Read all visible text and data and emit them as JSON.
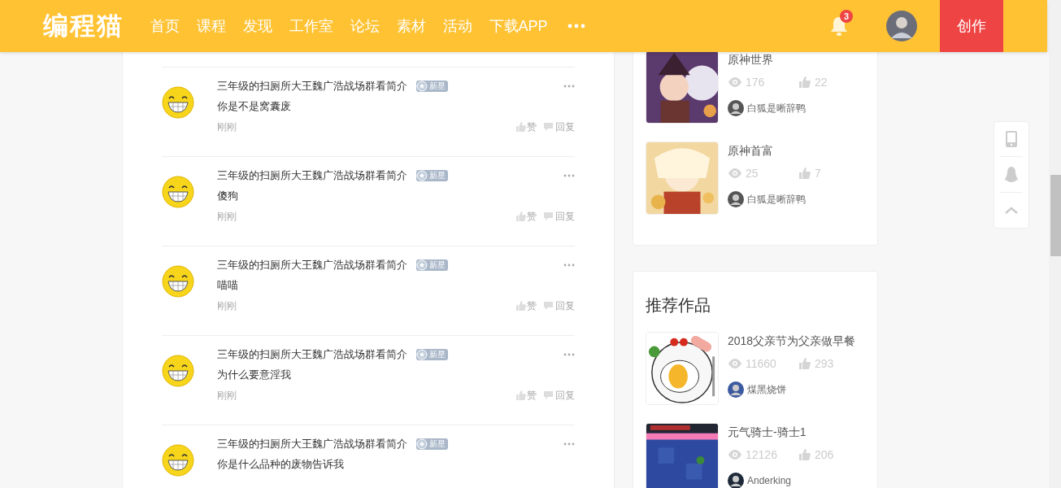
{
  "header": {
    "logo": "编程猫",
    "nav": [
      "首页",
      "课程",
      "发现",
      "工作室",
      "论坛",
      "素材",
      "活动",
      "下载APP"
    ],
    "notification_count": "3",
    "create_button": "创作"
  },
  "comments": [
    {
      "author": "三年级的扫厕所大王魏广浩战场群看简介",
      "badge": "新星",
      "text": "你是不是窝囊废",
      "time": "刚刚",
      "like": "赞",
      "reply": "回复"
    },
    {
      "author": "三年级的扫厕所大王魏广浩战场群看简介",
      "badge": "新星",
      "text": "傻狗",
      "time": "刚刚",
      "like": "赞",
      "reply": "回复"
    },
    {
      "author": "三年级的扫厕所大王魏广浩战场群看简介",
      "badge": "新星",
      "text": "喵喵",
      "time": "刚刚",
      "like": "赞",
      "reply": "回复"
    },
    {
      "author": "三年级的扫厕所大王魏广浩战场群看简介",
      "badge": "新星",
      "text": "为什么要意淫我",
      "time": "刚刚",
      "like": "赞",
      "reply": "回复"
    },
    {
      "author": "三年级的扫厕所大王魏广浩战场群看简介",
      "badge": "新星",
      "text": "你是什么品种的废物告诉我"
    }
  ],
  "author_works": [
    {
      "title": "原神世界",
      "views": "176",
      "likes": "22",
      "author": "白狐是晰辞鸭",
      "kind": "picture"
    },
    {
      "title": "原神首富",
      "views": "25",
      "likes": "7",
      "author": "白狐是晰辞鸭",
      "kind": "picture"
    }
  ],
  "recommended": {
    "title": "推荐作品",
    "works": [
      {
        "title": "2018父亲节为父亲做早餐",
        "views": "11660",
        "likes": "293",
        "author": "煤黑烧饼",
        "kind": "picture"
      },
      {
        "title": "元气骑士-骑士1",
        "views": "12126",
        "likes": "206",
        "author": "Anderking",
        "kind": "picture"
      }
    ]
  }
}
